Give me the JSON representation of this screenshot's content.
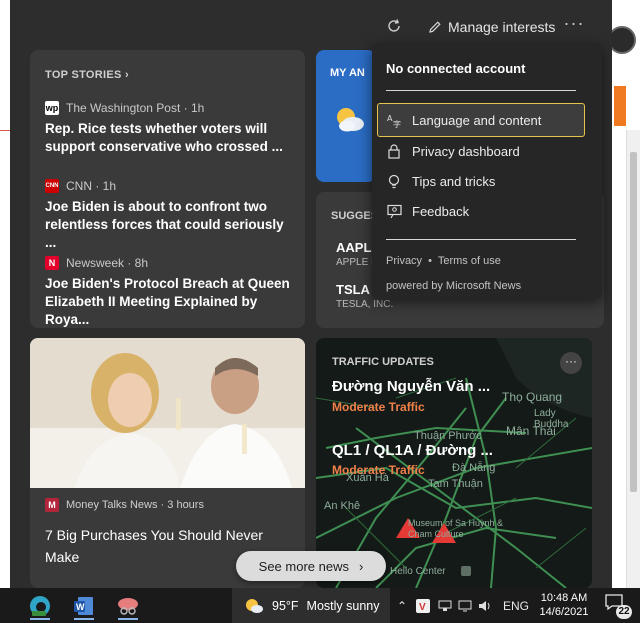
{
  "colors": {
    "panel_bg": "#2d2d2d",
    "card_bg": "#3a3a3a",
    "weather_bg": "#2b6cc4",
    "traffic_status": "#f0804a",
    "menu_highlight_border": "#e3c54a"
  },
  "topbar": {
    "manage_label": "Manage interests",
    "refresh_icon": "refresh-icon",
    "more_label": "···"
  },
  "top_stories": {
    "header": "TOP STORIES",
    "items": [
      {
        "source": "The Washington Post · 1h",
        "logo": "wp",
        "headline": "Rep. Rice tests whether voters will support conservative who crossed ..."
      },
      {
        "source": "CNN · 1h",
        "logo": "CNN",
        "headline": "Joe Biden is about to confront two relentless forces that could seriously ..."
      },
      {
        "source": "Newsweek · 8h",
        "logo": "N",
        "headline": "Joe Biden's Protocol Breach at Queen Elizabeth II Meeting Explained by Roya..."
      }
    ]
  },
  "weather_card": {
    "title": "MY AN"
  },
  "suggested": {
    "title": "SUGGES",
    "stocks": [
      {
        "symbol": "AAPL",
        "name": "APPLE I"
      },
      {
        "symbol": "TSLA",
        "name": "TESLA, INC."
      }
    ]
  },
  "menu": {
    "title": "No connected account",
    "items": [
      {
        "label": "Language and content",
        "icon": "language-icon",
        "active": true
      },
      {
        "label": "Privacy dashboard",
        "icon": "lock-icon",
        "active": false
      },
      {
        "label": "Tips and tricks",
        "icon": "lightbulb-icon",
        "active": false
      },
      {
        "label": "Feedback",
        "icon": "feedback-icon",
        "active": false
      }
    ],
    "privacy_link": "Privacy",
    "separator": "•",
    "terms_link": "Terms of use",
    "powered_by": "powered by Microsoft News"
  },
  "article": {
    "source": "Money Talks News · 3 hours",
    "headline": "7 Big Purchases You Should Never Make"
  },
  "traffic": {
    "title": "TRAFFIC UPDATES",
    "routes": [
      {
        "name": "Đường Nguyễn Văn ...",
        "status": "Moderate Traffic"
      },
      {
        "name": "QL1 / QL1A / Đường ...",
        "status": "Moderate Traffic"
      }
    ],
    "map_labels": [
      "Thọ Quang",
      "Lady Buddha",
      "Mân Thái",
      "Thuận Phước",
      "Đà Nẵng",
      "Tam Thuận",
      "Xuân Hà",
      "An Khê",
      "Museum of Sa Huỳnh & Cham Culture",
      "Hello Center"
    ]
  },
  "see_more": {
    "label": "See more news"
  },
  "taskbar": {
    "weather_temp": "95°F",
    "weather_text": "Mostly sunny",
    "language": "ENG",
    "time": "10:48 AM",
    "date": "14/6/2021",
    "notification_count": "22"
  }
}
